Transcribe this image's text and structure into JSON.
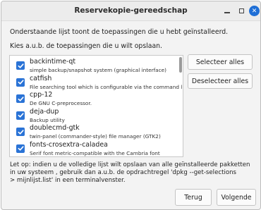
{
  "window": {
    "title": "Reservekopie-gereedschap"
  },
  "intro": {
    "line1": "Onderstaande lijst toont de toepassingen die u hebt geïnstalleerd.",
    "line2": "Kies a.u.b. de toepassingen die u wilt opslaan."
  },
  "packages": [
    {
      "name": "backintime-qt",
      "desc": "simple backup/snapshot system (graphical interface)",
      "checked": true
    },
    {
      "name": "catfish",
      "desc": "File searching tool which is configurable via the command line",
      "checked": true
    },
    {
      "name": "cpp-12",
      "desc": "De GNU C-preprocessor.",
      "checked": true
    },
    {
      "name": "deja-dup",
      "desc": "Backup utility",
      "checked": true
    },
    {
      "name": "doublecmd-gtk",
      "desc": "twin-panel (commander-style) file manager (GTK2)",
      "checked": true
    },
    {
      "name": "fonts-crosextra-caladea",
      "desc": "Serif font metric-compatible with the Cambria font",
      "checked": true
    }
  ],
  "buttons": {
    "select_all": "Selecteer alles",
    "deselect_all": "Deselecteer alles",
    "back": "Terug",
    "next": "Volgende"
  },
  "note": {
    "line1": "Let op: indien u de volledige lijst wilt opslaan van alle geïnstalleerde pakketten",
    "line2": "in uw systeem , gebruik dan a.u.b. de opdrachtregel 'dpkg --get-selections",
    "line3": "> mijnlijst.list' in een terminalvenster."
  },
  "colors": {
    "accent": "#2a73d6",
    "close_button": "#1f6fd6"
  }
}
